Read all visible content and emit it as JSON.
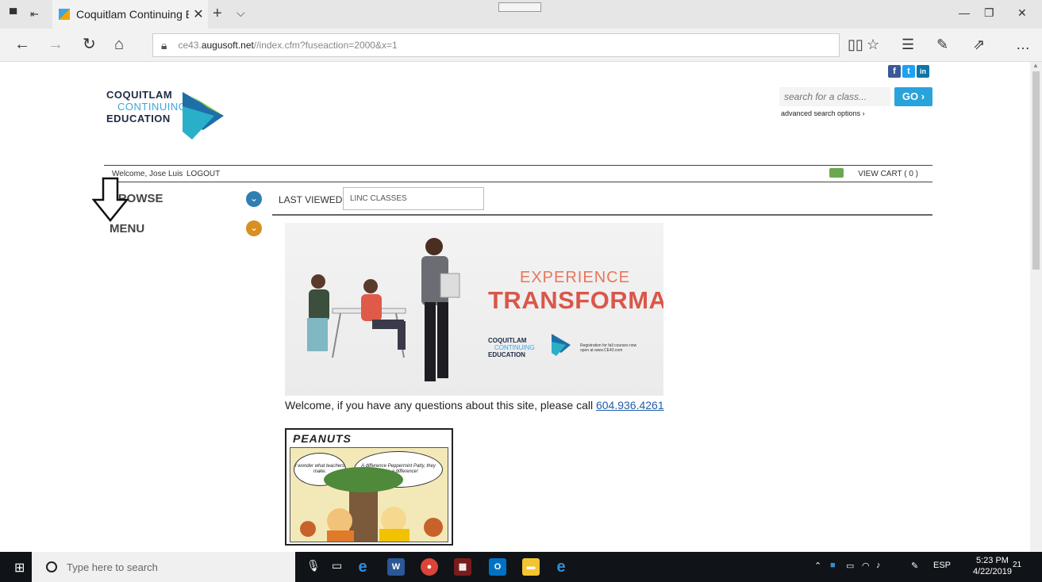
{
  "browser": {
    "tab_title": "Coquitlam Continuing E",
    "url_prefix": "ce43.",
    "url_host": "augusoft.net",
    "url_path": "//index.cfm?fuseaction=2000&x=1"
  },
  "header": {
    "social": [
      "f",
      "t",
      "in"
    ],
    "logo": {
      "line1": "COQUITLAM",
      "line2": "CONTINUING",
      "line3": "EDUCATION"
    },
    "search_placeholder": "search for a class...",
    "go_label": "GO ›",
    "advanced_search": "advanced search options ›"
  },
  "userbar": {
    "welcome": "Welcome, Jose Luis",
    "logout": "LOGOUT",
    "cart": "VIEW CART ( 0 )"
  },
  "sidebar": {
    "browse": "BROWSE",
    "menu": "MENU"
  },
  "tabs": {
    "last_viewed": "LAST VIEWED",
    "linc_classes": "LINC CLASSES"
  },
  "banner": {
    "experience": "EXPERIENCE",
    "transformation": "TRANSFORMATION",
    "logo_line1": "COQUITLAM",
    "logo_line2": "CONTINUING",
    "logo_line3": "EDUCATION",
    "registration": "Registration for fall courses now open at www.CE43.com"
  },
  "content": {
    "welcome_text": "Welcome, if you have any questions about this site, please call ",
    "phone": "604.936.4261"
  },
  "comic": {
    "title": "PEANUTS",
    "bubble_left": "I wonder what teachers make.",
    "bubble_right": "A difference Peppermint Patty, they make a difference!"
  },
  "taskbar": {
    "search_placeholder": "Type here to search",
    "language": "ESP",
    "time": "5:23 PM",
    "date": "4/22/2019",
    "notifications": "21"
  },
  "colors": {
    "accent_blue": "#29a3dc",
    "browse_circle": "#2f7fb3",
    "menu_circle": "#d98f22",
    "banner_title": "#d9574a"
  }
}
